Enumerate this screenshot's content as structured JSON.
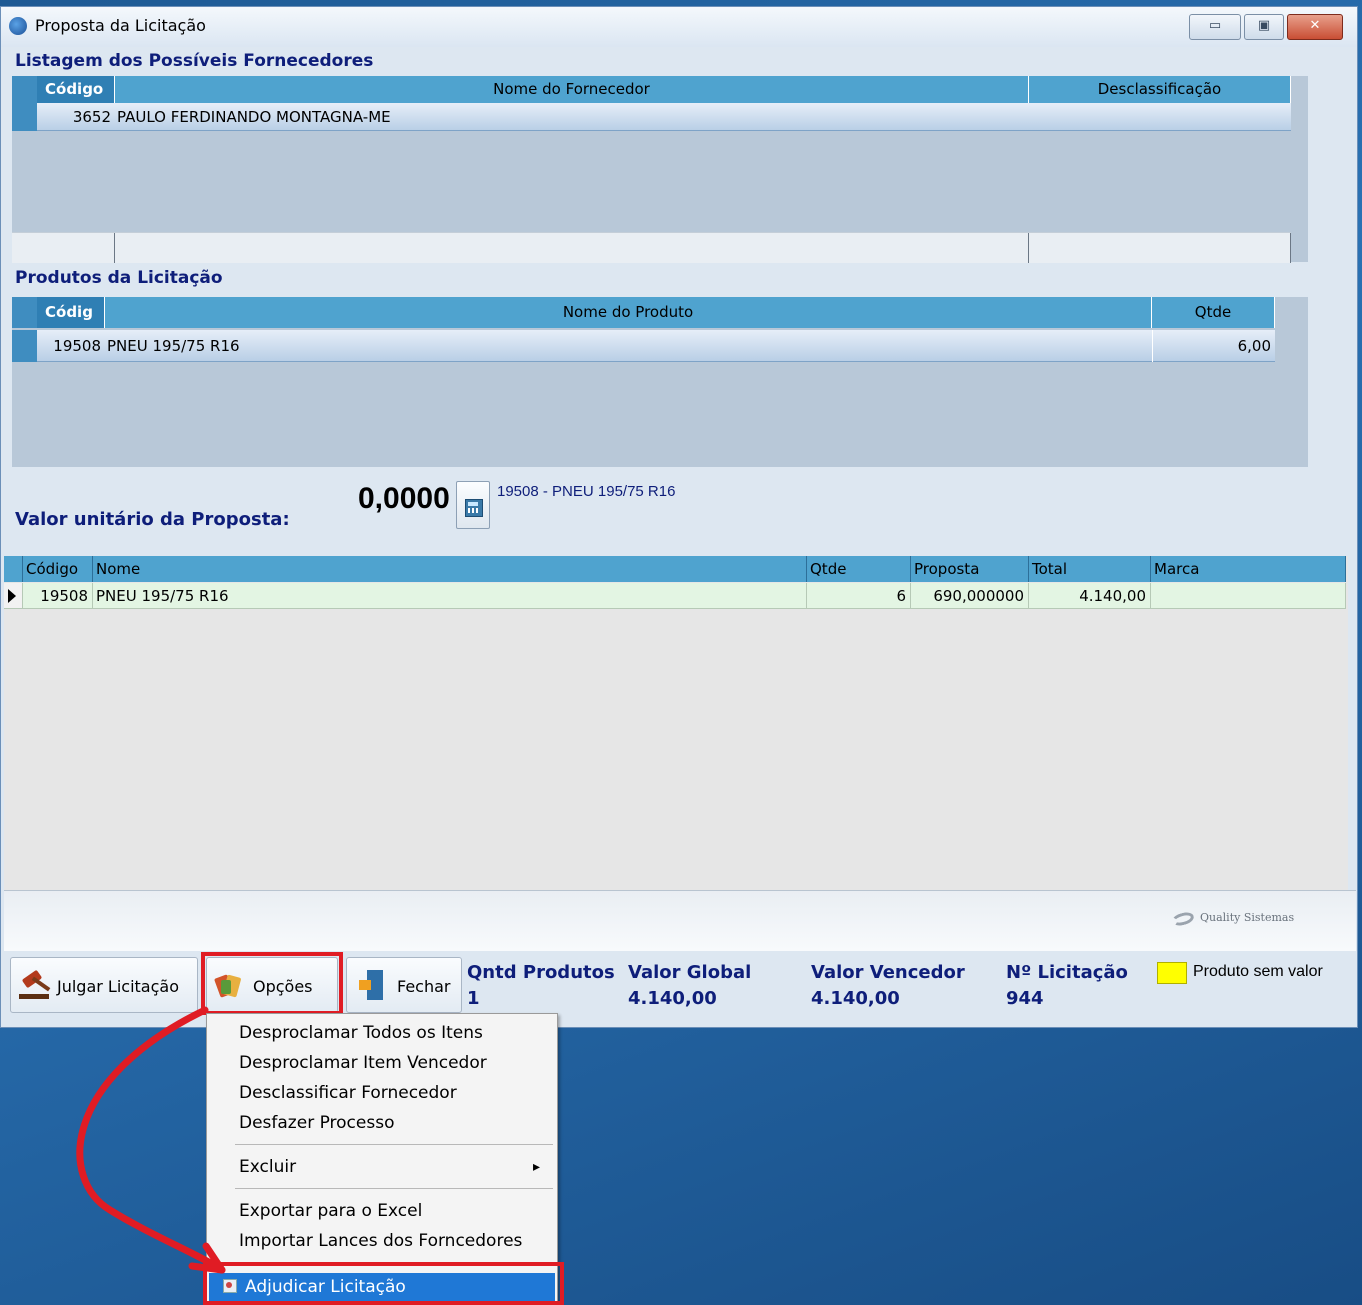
{
  "window": {
    "title": "Proposta da Licitação",
    "controls": {
      "minimize": "▭",
      "maximize": "▣",
      "close": "✕"
    }
  },
  "suppliers": {
    "section_title": "Listagem dos Possíveis Fornecedores",
    "columns": [
      "Código",
      "Nome do Fornecedor",
      "Desclassificação"
    ],
    "rows": [
      {
        "codigo": "3652",
        "nome": "PAULO FERDINANDO MONTAGNA-ME",
        "desclassificacao": ""
      }
    ]
  },
  "products": {
    "section_title": "Produtos da Licitação",
    "columns": [
      "Códig",
      "Nome do Produto",
      "Qtde"
    ],
    "rows": [
      {
        "codigo": "19508",
        "nome": "PNEU 195/75 R16",
        "qtde": "6,00"
      }
    ]
  },
  "proposal": {
    "label": "Valor unitário da Proposta:",
    "value": "0,0000",
    "product_ref": "19508 - PNEU 195/75 R16",
    "calc_icon": "calculator-icon"
  },
  "proposal_grid": {
    "columns": [
      "Código",
      "Nome",
      "Qtde",
      "Proposta",
      "Total",
      "Marca"
    ],
    "rows": [
      {
        "codigo": "19508",
        "nome": "PNEU 195/75 R16",
        "qtde": "6",
        "proposta": "690,000000",
        "total": "4.140,00",
        "marca": ""
      }
    ]
  },
  "branding": {
    "logo_text": "Quality Sistemas"
  },
  "footer": {
    "julgar_label": "Julgar Licitação",
    "opcoes_label": "Opções",
    "fechar_label": "Fechar",
    "stats": [
      {
        "label": "Qntd Produtos",
        "value": "1"
      },
      {
        "label": "Valor Global",
        "value": "4.140,00"
      },
      {
        "label": "Valor Vencedor",
        "value": "4.140,00"
      },
      {
        "label": "Nº Licitação",
        "value": "944"
      }
    ],
    "legend_label": "Produto sem valor",
    "legend_color": "#ffff00"
  },
  "menu": {
    "items": [
      "Desproclamar Todos os Itens",
      "Desproclamar Item Vencedor",
      "Desclassificar Fornecedor",
      "Desfazer Processo",
      "Excluir",
      "Exportar para o Excel",
      "Importar Lances dos Forncedores",
      "Adjudicar Licitação"
    ],
    "submenu_arrow": "▸"
  },
  "colors": {
    "highlight": "#e01c24",
    "menu_selected": "#1f78d6",
    "accent_title": "#0e1e7a"
  }
}
